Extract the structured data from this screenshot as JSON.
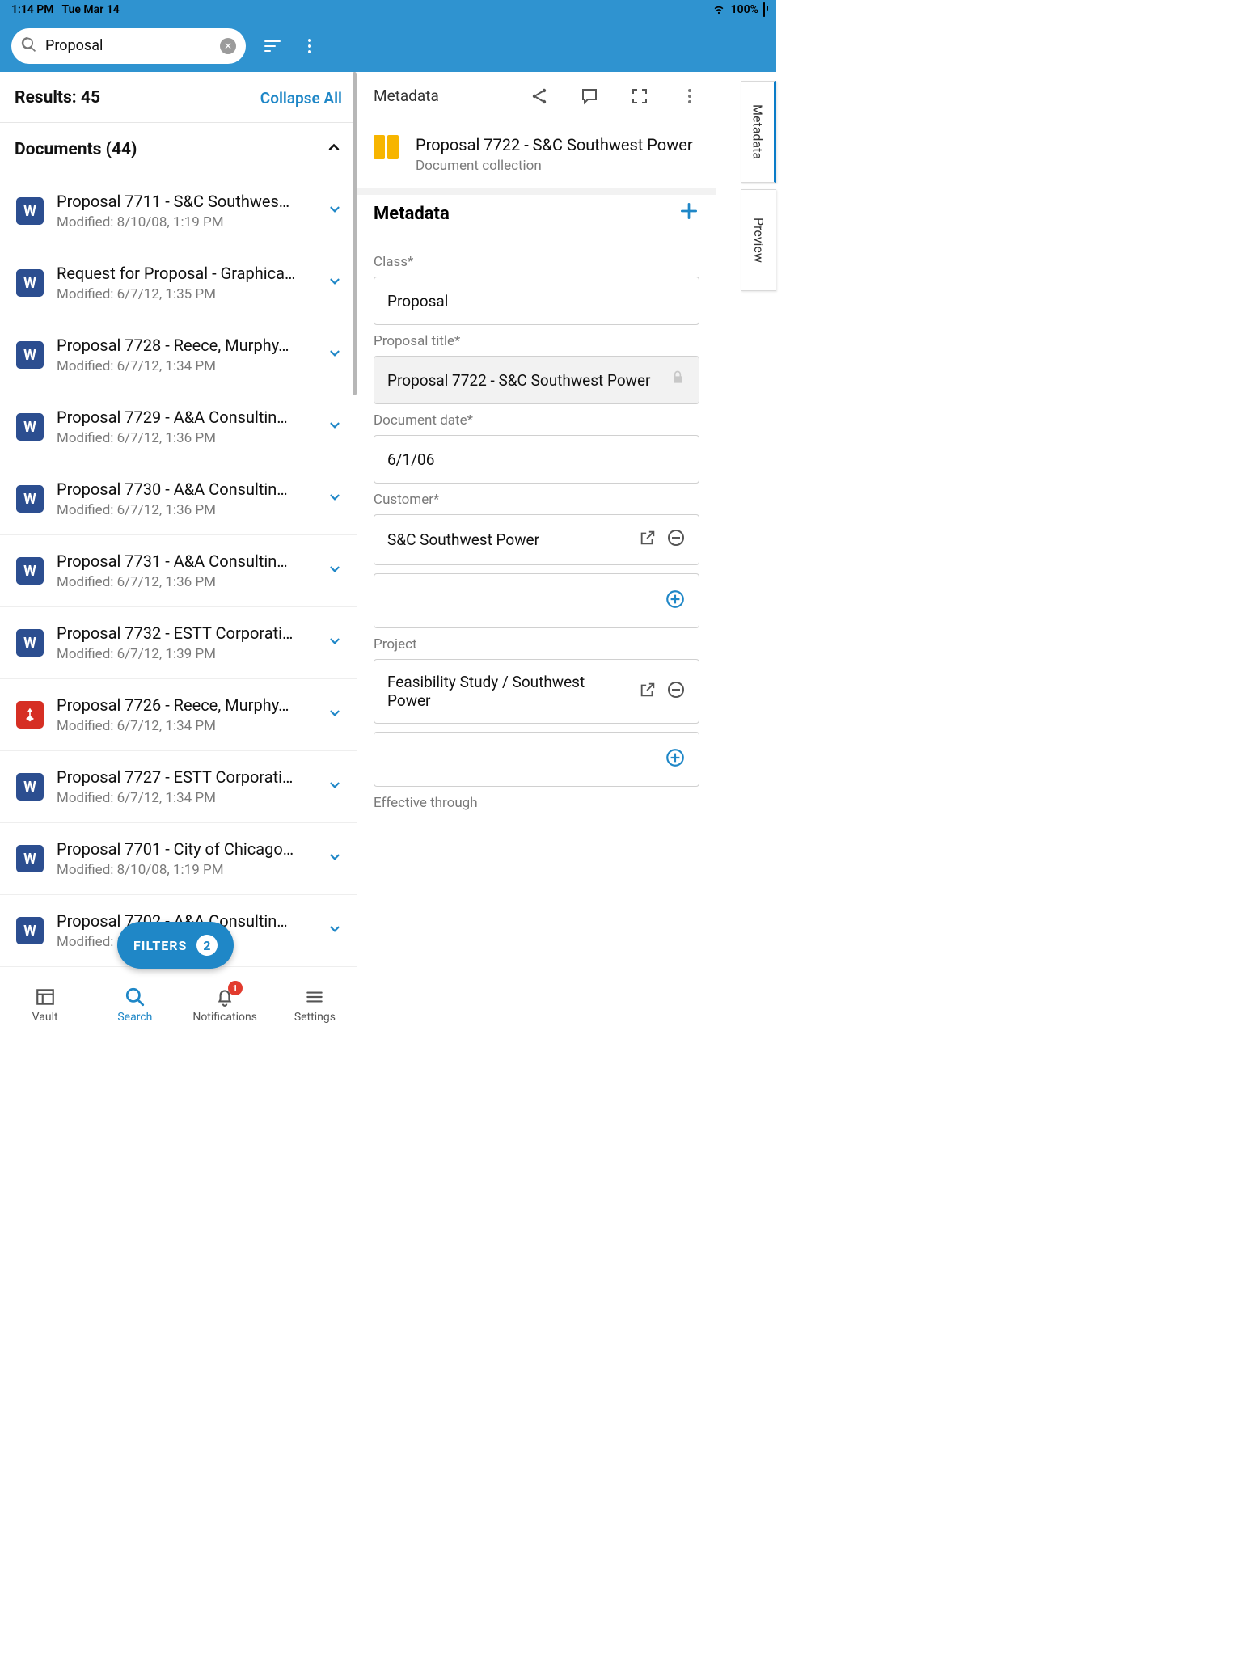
{
  "status": {
    "time": "1:14 PM",
    "date": "Tue Mar 14",
    "battery_pct": "100%"
  },
  "topbar": {
    "search_value": "Proposal"
  },
  "results": {
    "count_label": "Results: 45",
    "collapse_label": "Collapse All",
    "group_label": "Documents (44)",
    "rows": [
      {
        "icon": "word",
        "title": "Proposal 7711 - S&C Southwes…",
        "subtitle": "Modified: 8/10/08, 1:19 PM"
      },
      {
        "icon": "word",
        "title": "Request for Proposal - Graphica…",
        "subtitle": "Modified: 6/7/12, 1:35 PM"
      },
      {
        "icon": "word",
        "title": "Proposal 7728 - Reece, Murphy…",
        "subtitle": "Modified: 6/7/12, 1:34 PM"
      },
      {
        "icon": "word",
        "title": "Proposal 7729 - A&A Consultin…",
        "subtitle": "Modified: 6/7/12, 1:36 PM"
      },
      {
        "icon": "word",
        "title": "Proposal 7730 - A&A Consultin…",
        "subtitle": "Modified: 6/7/12, 1:36 PM"
      },
      {
        "icon": "word",
        "title": "Proposal 7731 - A&A Consultin…",
        "subtitle": "Modified: 6/7/12, 1:36 PM"
      },
      {
        "icon": "word",
        "title": "Proposal 7732 - ESTT Corporati…",
        "subtitle": "Modified: 6/7/12, 1:39 PM"
      },
      {
        "icon": "pdf",
        "title": "Proposal 7726 - Reece, Murphy…",
        "subtitle": "Modified: 6/7/12, 1:34 PM"
      },
      {
        "icon": "word",
        "title": "Proposal 7727 - ESTT Corporati…",
        "subtitle": "Modified: 6/7/12, 1:34 PM"
      },
      {
        "icon": "word",
        "title": "Proposal 7701 - City of Chicago…",
        "subtitle": "Modified: 8/10/08, 1:19 PM"
      },
      {
        "icon": "word",
        "title": "Proposal 7702 - A&A Consultin…",
        "subtitle": "Modified: 8/10/08, 1:19 PM"
      }
    ]
  },
  "filters": {
    "label": "FILTERS",
    "count": "2"
  },
  "detail": {
    "header_label": "Metadata",
    "doc_title": "Proposal 7722 - S&C Southwest Power",
    "doc_type": "Document collection",
    "metadata_label": "Metadata",
    "fields": {
      "class_label": "Class*",
      "class_value": "Proposal",
      "proposal_title_label": "Proposal title*",
      "proposal_title_value": "Proposal 7722 - S&C Southwest Power",
      "doc_date_label": "Document date*",
      "doc_date_value": "6/1/06",
      "customer_label": "Customer*",
      "customer_value": "S&C Southwest Power",
      "project_label": "Project",
      "project_value": "Feasibility Study / Southwest Power",
      "effective_label": "Effective through"
    }
  },
  "side_tabs": {
    "metadata": "Metadata",
    "preview": "Preview"
  },
  "bottom": {
    "vault": "Vault",
    "search": "Search",
    "notifications": "Notifications",
    "settings": "Settings",
    "notif_count": "1"
  }
}
